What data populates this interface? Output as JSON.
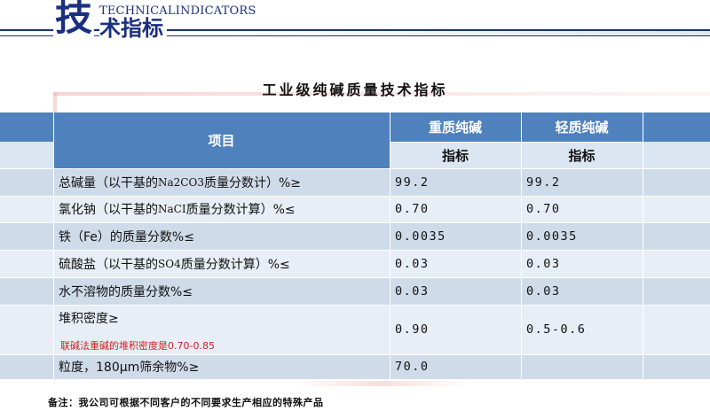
{
  "header": {
    "big_char": "技",
    "english": "TECHNICALINDICATORS",
    "small_chars": "术指标"
  },
  "title": "工业级纯碱质量技术指标",
  "table": {
    "col_item": "项目",
    "col_heavy": "重质纯碱",
    "col_light": "轻质纯碱",
    "sub_heavy": "指标",
    "sub_light": "指标",
    "rows": [
      {
        "pre": "总碱量（以干基的",
        "formula_a": "Na",
        "formula_sub1": "2",
        "formula_b": "CO",
        "formula_sub2": "3",
        "post": "质量分数计）%≥",
        "heavy": "99.2",
        "light": "99.2"
      },
      {
        "pre": "氯化钠（以干基的",
        "formula_a": "NaCI",
        "post": "质量分数计算）%≤",
        "heavy": "0.70",
        "light": "0.70"
      },
      {
        "label": "铁（Fe）的质量分数%≤",
        "heavy": "0.0035",
        "light": "0.0035"
      },
      {
        "pre": "硫酸盐（以干基的",
        "formula_a": "SO",
        "formula_sub1": "4",
        "post": "质量分数计算）%≤",
        "heavy": "0.03",
        "light": "0.03"
      },
      {
        "label": "水不溶物的质量分数%≤",
        "heavy": "0.03",
        "light": "0.03"
      },
      {
        "label": "堆积密度≥",
        "note": "联碱法重碱的堆积密度是0.70-0.85",
        "heavy": "0.90",
        "light": "0.5-0.6"
      },
      {
        "label": "粒度，180μm筛余物%≥",
        "heavy": "70.0",
        "light": ""
      }
    ]
  },
  "footnote": "备注：我公司可根据不同客户的不同要求生产相应的特殊产品",
  "colors": {
    "brand": "#1a2f80",
    "header_blue": "#4f81bd",
    "row_dark": "#d0dbe9",
    "row_light": "#e8eef6",
    "note_red": "#d02020"
  }
}
